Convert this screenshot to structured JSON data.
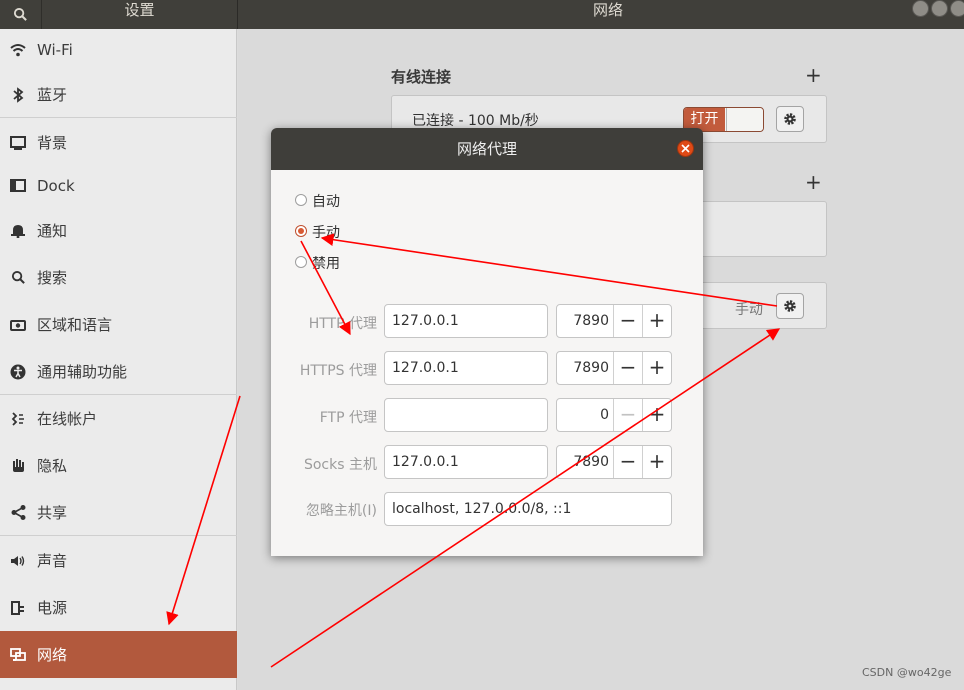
{
  "header": {
    "left_title": "设置",
    "title": "网络"
  },
  "sidebar": {
    "items": [
      {
        "label": "Wi-Fi",
        "icon": "wifi-icon"
      },
      {
        "label": "蓝牙",
        "icon": "bluetooth-icon"
      },
      {
        "label": "背景",
        "icon": "background-icon"
      },
      {
        "label": "Dock",
        "icon": "dock-icon"
      },
      {
        "label": "通知",
        "icon": "bell-icon"
      },
      {
        "label": "搜索",
        "icon": "search-icon"
      },
      {
        "label": "区域和语言",
        "icon": "camera-icon"
      },
      {
        "label": "通用辅助功能",
        "icon": "accessibility-icon"
      },
      {
        "label": "在线帐户",
        "icon": "online-accounts-icon"
      },
      {
        "label": "隐私",
        "icon": "hand-icon"
      },
      {
        "label": "共享",
        "icon": "share-icon"
      },
      {
        "label": "声音",
        "icon": "speaker-icon"
      },
      {
        "label": "电源",
        "icon": "power-icon"
      },
      {
        "label": "网络",
        "icon": "network-icon",
        "active": true
      }
    ]
  },
  "main": {
    "wired_title": "有线连接",
    "wired_status": "已连接 - 100 Mb/秒",
    "switch_label": "打开",
    "proxy_status": "手动"
  },
  "dialog": {
    "title": "网络代理",
    "radio_options": [
      {
        "label": "自动",
        "checked": false
      },
      {
        "label": "手动",
        "checked": true
      },
      {
        "label": "禁用",
        "checked": false
      }
    ],
    "rows": [
      {
        "label": "HTTP 代理",
        "host": "127.0.0.1",
        "port": "7890"
      },
      {
        "label": "HTTPS 代理",
        "host": "127.0.0.1",
        "port": "7890"
      },
      {
        "label": "FTP 代理",
        "host": "",
        "port": "0"
      },
      {
        "label": "Socks 主机",
        "host": "127.0.0.1",
        "port": "7890"
      }
    ],
    "ignore_label": "忽略主机(I)",
    "ignore_value": "localhost, 127.0.0.0/8, ::1"
  },
  "watermark": "CSDN @wo42ge",
  "colors": {
    "accent": "#b2593d",
    "close": "#df4a16",
    "arrow": "#ff0000"
  }
}
